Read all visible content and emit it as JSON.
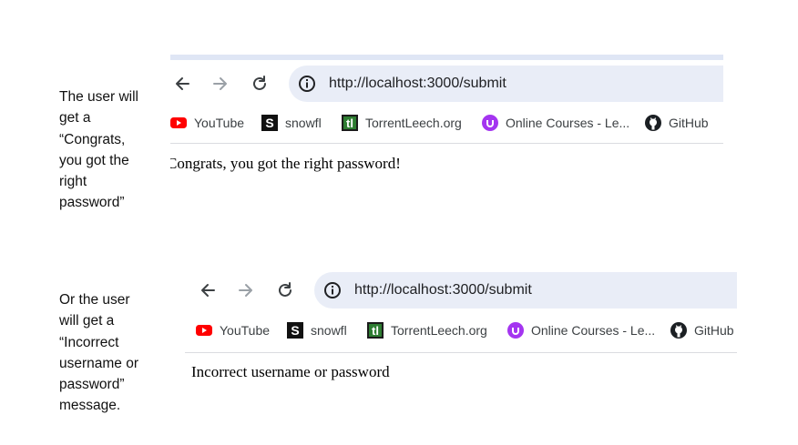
{
  "captions": {
    "success": [
      "The user will",
      "get a",
      "“Congrats,",
      "you got the",
      "right",
      "password”"
    ],
    "failure": [
      "Or the user",
      "will get a",
      "“Incorrect",
      "username or",
      "password”",
      "message."
    ]
  },
  "browser": {
    "url": "http://localhost:3000/submit",
    "bookmarks": [
      {
        "label": "YouTube",
        "icon": "youtube-icon"
      },
      {
        "label": "snowfl",
        "icon": "snowfl-icon"
      },
      {
        "label": "TorrentLeech.org",
        "icon": "torrentleech-icon"
      },
      {
        "label": "Online Courses - Le...",
        "icon": "udemy-icon"
      },
      {
        "label": "GitHub",
        "icon": "github-icon"
      }
    ]
  },
  "screens": {
    "success_message": "Congrats, you got the right password!",
    "failure_message": "Incorrect username or password"
  },
  "colors": {
    "url_bar": "#e9edf7",
    "youtube": "#ff0000",
    "udemy": "#a435f0",
    "torrentleech": "#2e7d32"
  }
}
